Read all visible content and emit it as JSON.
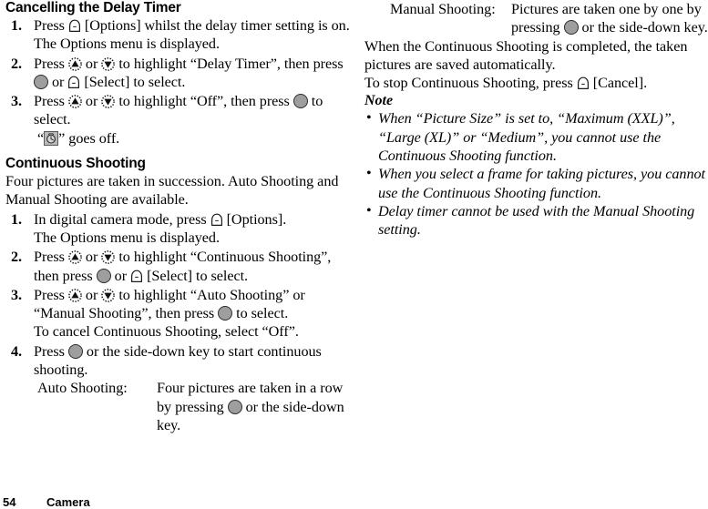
{
  "page": {
    "number": "54",
    "chapter": "Camera"
  },
  "icons": {
    "softkey": "softkey-icon",
    "center_key": "center-select-key-icon",
    "nav_up": "nav-up-key-icon",
    "nav_down": "nav-down-key-icon",
    "delay_timer": "delay-timer-indicator-icon"
  },
  "left_column": {
    "section_cancelling": {
      "heading": "Cancelling the Delay Timer",
      "steps": [
        {
          "num": "1.",
          "parts": [
            {
              "type": "text",
              "value": "Press "
            },
            {
              "type": "icon",
              "value": "softkey"
            },
            {
              "type": "text",
              "value": " [Options] whilst the delay timer setting is on."
            }
          ],
          "sub": "The Options menu is displayed."
        },
        {
          "num": "2.",
          "parts": [
            {
              "type": "text",
              "value": "Press "
            },
            {
              "type": "icon",
              "value": "nav_up"
            },
            {
              "type": "text",
              "value": " or "
            },
            {
              "type": "icon",
              "value": "nav_down"
            },
            {
              "type": "text",
              "value": " to highlight “Delay Timer”, then press "
            },
            {
              "type": "icon",
              "value": "center_key"
            },
            {
              "type": "text",
              "value": " or "
            },
            {
              "type": "icon",
              "value": "softkey"
            },
            {
              "type": "text",
              "value": " [Select] to select."
            }
          ]
        },
        {
          "num": "3.",
          "parts": [
            {
              "type": "text",
              "value": "Press "
            },
            {
              "type": "icon",
              "value": "nav_up"
            },
            {
              "type": "text",
              "value": " or "
            },
            {
              "type": "icon",
              "value": "nav_down"
            },
            {
              "type": "text",
              "value": " to highlight “Off”, then press "
            },
            {
              "type": "icon",
              "value": "center_key"
            },
            {
              "type": "text",
              "value": " to select."
            }
          ],
          "sub_icon_line": {
            "before": "“",
            "icon": "delay_timer",
            "after": "” goes off."
          }
        }
      ]
    },
    "section_continuous": {
      "heading": "Continuous Shooting",
      "intro": "Four pictures are taken in succession. Auto Shooting and Manual Shooting are available.",
      "steps": [
        {
          "num": "1.",
          "parts": [
            {
              "type": "text",
              "value": "In digital camera mode, press "
            },
            {
              "type": "icon",
              "value": "softkey"
            },
            {
              "type": "text",
              "value": " [Options]."
            }
          ],
          "sub": "The Options menu is displayed."
        },
        {
          "num": "2.",
          "parts": [
            {
              "type": "text",
              "value": "Press "
            },
            {
              "type": "icon",
              "value": "nav_up"
            },
            {
              "type": "text",
              "value": " or "
            },
            {
              "type": "icon",
              "value": "nav_down"
            },
            {
              "type": "text",
              "value": " to highlight “Continuous Shooting”, then press "
            },
            {
              "type": "icon",
              "value": "center_key"
            },
            {
              "type": "text",
              "value": " or "
            },
            {
              "type": "icon",
              "value": "softkey"
            },
            {
              "type": "text",
              "value": " [Select] to select."
            }
          ]
        },
        {
          "num": "3.",
          "parts": [
            {
              "type": "text",
              "value": "Press "
            },
            {
              "type": "icon",
              "value": "nav_up"
            },
            {
              "type": "text",
              "value": " or "
            },
            {
              "type": "icon",
              "value": "nav_down"
            },
            {
              "type": "text",
              "value": " to highlight “Auto Shooting” or “Manual Shooting”, then press "
            },
            {
              "type": "icon",
              "value": "center_key"
            },
            {
              "type": "text",
              "value": " to select."
            }
          ],
          "sub": "To cancel Continuous Shooting, select “Off”."
        },
        {
          "num": "4.",
          "parts": [
            {
              "type": "text",
              "value": "Press "
            },
            {
              "type": "icon",
              "value": "center_key"
            },
            {
              "type": "text",
              "value": " or the side-down key to start continuous shooting."
            }
          ]
        }
      ],
      "definition": {
        "term": "Auto Shooting:",
        "desc_parts": [
          {
            "type": "text",
            "value": "Four pictures are taken in a row by pressing "
          },
          {
            "type": "icon",
            "value": "center_key"
          },
          {
            "type": "text",
            "value": " or the side-down key."
          }
        ]
      }
    }
  },
  "right_column": {
    "definition": {
      "term": "Manual Shooting:",
      "desc_parts": [
        {
          "type": "text",
          "value": "Pictures are taken one by one by pressing "
        },
        {
          "type": "icon",
          "value": "center_key"
        },
        {
          "type": "text",
          "value": " or the side-down key."
        }
      ]
    },
    "paragraphs": [
      {
        "parts": [
          {
            "type": "text",
            "value": "When the Continuous Shooting is completed, the taken pictures are saved automatically."
          }
        ]
      },
      {
        "parts": [
          {
            "type": "text",
            "value": "To stop Continuous Shooting, press "
          },
          {
            "type": "icon",
            "value": "softkey"
          },
          {
            "type": "text",
            "value": " [Cancel]."
          }
        ]
      }
    ],
    "note": {
      "title": "Note",
      "bullet": "•",
      "items": [
        "When “Picture Size” is set to, “Maximum (XXL)”, “Large (XL)” or “Medium”, you cannot use the Continuous Shooting function.",
        "When you select a frame for taking pictures, you cannot use the Continuous Shooting function.",
        "Delay timer cannot be used with the Manual Shooting setting."
      ]
    }
  }
}
